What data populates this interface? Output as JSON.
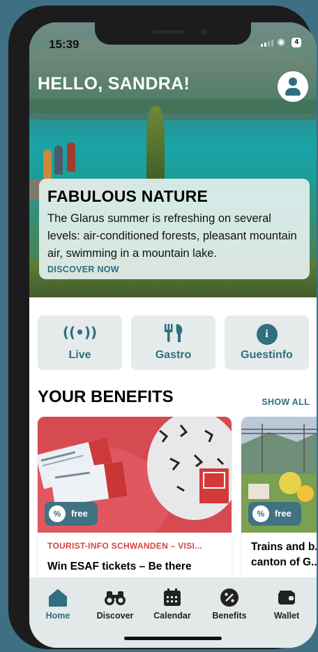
{
  "status_bar": {
    "time": "15:39",
    "battery": "4"
  },
  "header": {
    "greeting": "HELLO, SANDRA!",
    "profile_icon": "user-icon"
  },
  "hero": {
    "title": "FABULOUS NATURE",
    "body": "The Glarus summer is refreshing on several levels: air-conditioned forests, pleasant mountain air, swimming in a mountain lake.",
    "cta": "DISCOVER NOW"
  },
  "quick_actions": [
    {
      "label": "Live",
      "icon": "broadcast-icon"
    },
    {
      "label": "Gastro",
      "icon": "fork-knife-icon"
    },
    {
      "label": "Guestinfo",
      "icon": "info-icon"
    }
  ],
  "benefits": {
    "title": "YOUR BENEFITS",
    "show_all": "SHOW ALL",
    "cards": [
      {
        "badge": "free",
        "category": "TOURIST-INFO SCHWANDEN – VISI...",
        "title": "Win ESAF tickets – Be there"
      },
      {
        "badge": "free",
        "category": "",
        "title": "Trains and b... canton of G..."
      }
    ]
  },
  "tabbar": {
    "items": [
      {
        "label": "Home",
        "icon": "home-icon",
        "active": true
      },
      {
        "label": "Discover",
        "icon": "binoculars-icon",
        "active": false
      },
      {
        "label": "Calendar",
        "icon": "calendar-icon",
        "active": false
      },
      {
        "label": "Benefits",
        "icon": "percent-icon",
        "active": false
      },
      {
        "label": "Wallet",
        "icon": "wallet-icon",
        "active": false
      }
    ]
  },
  "colors": {
    "accent": "#2f6f7e",
    "category_red": "#d64545",
    "badge_bg": "#3f7282",
    "tile_bg": "#e5eaeb"
  }
}
